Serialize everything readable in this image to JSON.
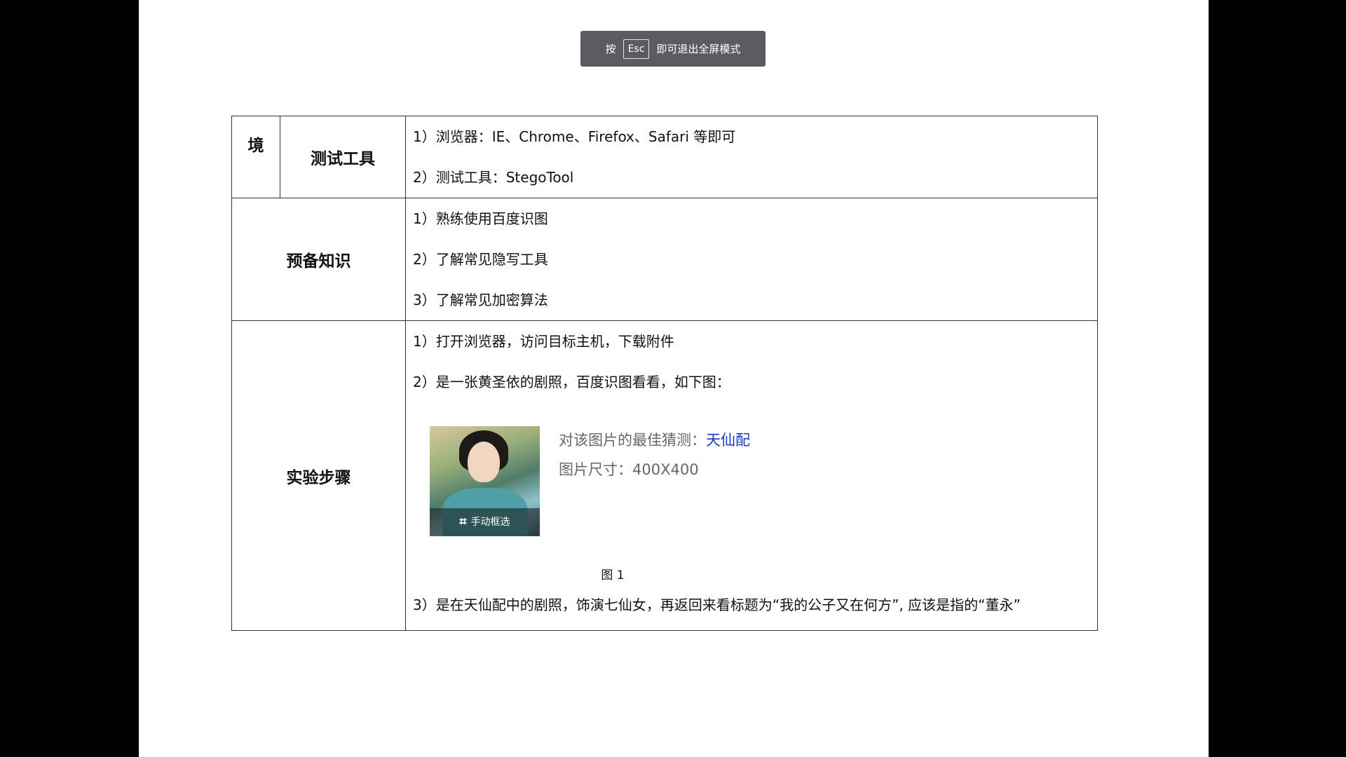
{
  "toast": {
    "prefix": "按",
    "key": "Esc",
    "suffix": "即可退出全屏模式"
  },
  "table": {
    "row1": {
      "left_label": "境",
      "label": "测试工具",
      "items": [
        "1）浏览器：IE、Chrome、Firefox、Safari 等即可",
        "2）测试工具：StegoTool"
      ]
    },
    "row2": {
      "label": "预备知识",
      "items": [
        "1）熟练使用百度识图",
        "2）了解常见隐写工具",
        "3）了解常见加密算法"
      ]
    },
    "row3": {
      "label": "实验步骤",
      "step1": "1）打开浏览器，访问目标主机，下载附件",
      "step2": "2）是一张黄圣依的剧照，百度识图看看，如下图：",
      "figure": {
        "crop_label": "手动框选",
        "guess_prefix": "对该图片的最佳猜测：",
        "guess_value": "天仙配",
        "size_text": "图片尺寸：400X400",
        "caption": "图 1"
      },
      "step3": "3）是在天仙配中的剧照，饰演七仙女，再返回来看标题为“我的公子又在何方”, 应该是指的“董永”"
    }
  }
}
